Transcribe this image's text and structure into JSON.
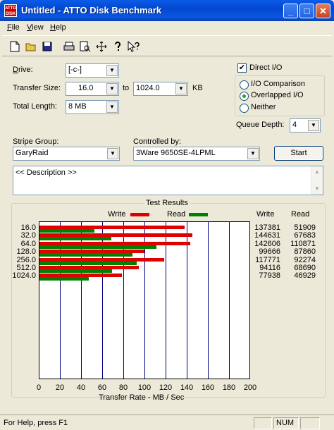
{
  "window": {
    "app_icon_text": "ATTO DISK",
    "title": "Untitled - ATTO Disk Benchmark",
    "minimize": "_",
    "maximize": "□",
    "close": "✕"
  },
  "menu": [
    {
      "accel": "F",
      "rest": "ile"
    },
    {
      "accel": "V",
      "rest": "iew"
    },
    {
      "accel": "H",
      "rest": "elp"
    }
  ],
  "toolbar": {
    "icons": [
      "new-file-icon",
      "open-folder-icon",
      "save-disk-icon",
      "print-icon",
      "print-preview-icon",
      "move-icon",
      "help-icon",
      "context-help-icon"
    ]
  },
  "drive": {
    "label_accel": "D",
    "label_rest": "rive:",
    "value": "[-c-]"
  },
  "transfer_size": {
    "label": "Transfer Size:",
    "from": "16.0",
    "to_label": "to",
    "to": "1024.0",
    "unit": "KB"
  },
  "total_length": {
    "label": "Total Length:",
    "value": "8 MB"
  },
  "options": {
    "direct_io": {
      "label": "Direct I/O",
      "checked": true
    },
    "io_comparison": {
      "label": "I/O Comparison",
      "selected": false
    },
    "overlapped_io": {
      "label": "Overlapped I/O",
      "selected": true
    },
    "neither": {
      "label": "Neither",
      "selected": false
    }
  },
  "queue_depth": {
    "label": "Queue Depth:",
    "value": "4"
  },
  "stripe_group": {
    "label": "Stripe Group:",
    "value": "GaryRaid"
  },
  "controlled_by": {
    "label": "Controlled by:",
    "value": "3Ware 9650SE-4LPML"
  },
  "start_button": "Start",
  "description": "<< Description >>",
  "results": {
    "title": "Test Results",
    "legend_write": "Write",
    "legend_read": "Read",
    "col_write": "Write",
    "col_read": "Read",
    "write_color": "#e00000",
    "read_color": "#008000",
    "xlabel": "Transfer Rate - MB / Sec",
    "x_ticks": [
      "0",
      "20",
      "40",
      "60",
      "80",
      "100",
      "120",
      "140",
      "160",
      "180",
      "200"
    ]
  },
  "chart_data": {
    "type": "bar",
    "orientation": "horizontal",
    "title": "Test Results",
    "xlabel": "Transfer Rate - MB / Sec",
    "xlim": [
      0,
      200
    ],
    "categories": [
      "16.0",
      "32.0",
      "64.0",
      "128.0",
      "256.0",
      "512.0",
      "1024.0"
    ],
    "series": [
      {
        "name": "Write",
        "values": [
          137381,
          144631,
          142606,
          99666,
          117771,
          94116,
          77938
        ]
      },
      {
        "name": "Read",
        "values": [
          51909,
          67683,
          110871,
          87860,
          92274,
          68690,
          46929
        ]
      }
    ]
  },
  "status": {
    "help": "For Help, press F1",
    "num": "NUM"
  }
}
